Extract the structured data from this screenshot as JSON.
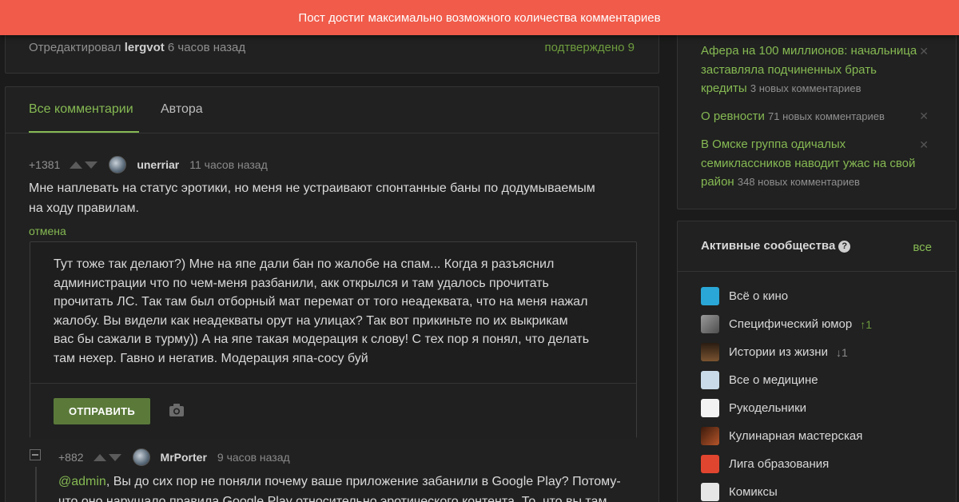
{
  "banner": {
    "text": "Пост достиг максимально возможного количества комментариев"
  },
  "post_meta": {
    "edited_prefix": "Отредактировал",
    "editor": "lergvot",
    "edited_time": "6 часов назад",
    "confirmed": "подтверждено 9"
  },
  "comments_tabs": [
    {
      "label": "Все комментарии",
      "active": true
    },
    {
      "label": "Автора",
      "active": false
    }
  ],
  "comments": [
    {
      "rating": "+1381",
      "user": "unerriar",
      "time": "11 часов назад",
      "text_line1": "Мне наплевать на статус эротики, но меня не устраивают спонтанные баны по додумываемым",
      "text_line2": "на ходу правилам.",
      "cancel": "отмена"
    },
    {
      "rating": "+882",
      "user": "MrPorter",
      "time": "9 часов назад",
      "mention": "@admin",
      "text_line1_rest": ", Вы до сих пор не поняли почему ваше приложение забанили в Google Play? Потому-",
      "text_line2": "что оно нарушало правила Google Play относительно эротического контента. То, что вы там"
    }
  ],
  "reply": {
    "lines": [
      "Тут тоже так делают?) Мне на япе дали бан по жалобе на спам... Когда я разъяснил",
      "администрации что по чем-меня разбанили, акк открылся и там удалось прочитать",
      "прочитать ЛС. Так там был отборный мат перемат от того неадеквата, что на меня нажал",
      "жалобу. Вы видели как неадекваты орут на улицах? Так вот прикиньте по их выкрикам",
      "вас бы сажали в турму)) А на япе такая модерация к слову! С тех пор я понял, что делать",
      "там нехер. Гавно и негатив. Модерация япа-сосу буй"
    ],
    "send_label": "ОТПРАВИТЬ",
    "camera_icon": "camera-icon"
  },
  "hot_posts": [
    {
      "line1": "Афера на 100 миллионов: начальница",
      "line2": "заставляла подчиненных брать",
      "line3": "кредиты",
      "count": "3 новых комментариев"
    },
    {
      "line1": "О ревности",
      "count": "71 новых комментариев"
    },
    {
      "line1": "В Омске группа одичалых",
      "line2": "семиклассников наводит ужас на свой",
      "line3": "район",
      "count": "348 новых комментариев"
    }
  ],
  "communities": {
    "title": "Активные сообщества",
    "all_label": "все",
    "items": [
      {
        "name": "Всё о кино",
        "color": "#2aa7d6",
        "trend": ""
      },
      {
        "name": "Специфический юмор",
        "color": "#7d7d7d",
        "trend": "1",
        "dir": "up"
      },
      {
        "name": "Истории из жизни",
        "color": "#5a3e2b",
        "trend": "1",
        "dir": "down"
      },
      {
        "name": "Все о медицине",
        "color": "#c9dbe8",
        "trend": ""
      },
      {
        "name": "Рукодельники",
        "color": "#f2f2f2",
        "trend": ""
      },
      {
        "name": "Кулинарная мастерская",
        "color": "#8a3a1c",
        "trend": ""
      },
      {
        "name": "Лига образования",
        "color": "#e0452f",
        "trend": ""
      },
      {
        "name": "Комиксы",
        "color": "#e6e6e6",
        "trend": ""
      }
    ]
  },
  "colors": {
    "accent": "#86b953",
    "banner": "#f05b4a",
    "send_button": "#5b7a3a"
  }
}
